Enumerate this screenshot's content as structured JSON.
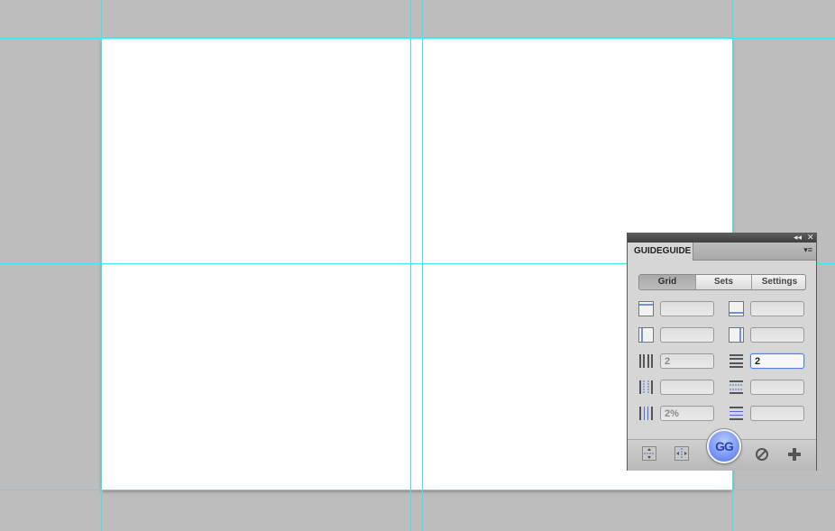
{
  "panel": {
    "title": "GUIDEGUIDE",
    "controls": {
      "collapse": "◂◂",
      "close": "✕",
      "menu": "▾≡"
    }
  },
  "tabs": [
    {
      "label": "Grid",
      "active": true
    },
    {
      "label": "Sets",
      "active": false
    },
    {
      "label": "Settings",
      "active": false
    }
  ],
  "fields": {
    "left_margin": "",
    "top_margin": "",
    "right_margin": "",
    "bottom_margin": "",
    "columns": "2",
    "rows": "2",
    "column_midpoint": "",
    "row_midpoint": "",
    "column_gutter": "2%",
    "row_gutter": ""
  },
  "footer": {
    "gg_label": "GG",
    "icons": [
      "horizontal-midpoint-icon",
      "vertical-midpoint-icon",
      "gg-button",
      "clear-guides-icon",
      "add-guide-icon"
    ]
  },
  "colors": {
    "guide": "#3fe6ee",
    "accent": "#6f8ff0",
    "pasteboard": "#bdbdbd"
  }
}
